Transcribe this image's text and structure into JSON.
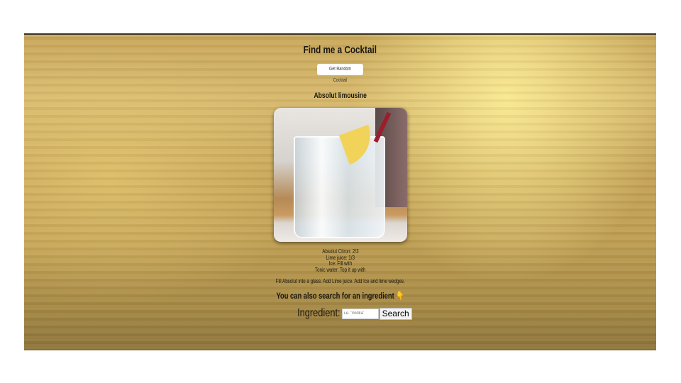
{
  "header": {
    "title": "Find me a Cocktail",
    "random_button": "Get Random Cocktail"
  },
  "cocktail": {
    "name": "Absolut limousine",
    "image_alt": "cocktail-photo",
    "ingredients": [
      "Absolut Citron: 2/3",
      "Lime juice: 1/3",
      "Ice: Fill with",
      "Tonic water: Top it up with"
    ],
    "instructions": "Fill Absolut into a glass. Add Lime juice. Add Ice and lime wedges."
  },
  "search": {
    "prompt": "You can also search for an ingredient",
    "prompt_icon": "pointing-down-hand-icon",
    "label": "Ingredient:",
    "placeholder": "i.e. 'Vodka'",
    "button": "Search"
  }
}
